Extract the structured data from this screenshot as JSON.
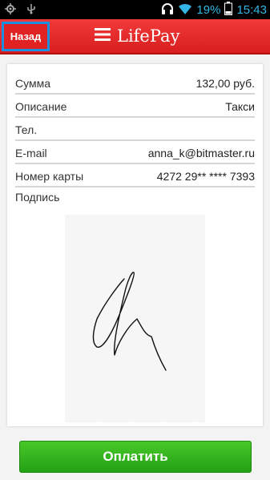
{
  "status_bar": {
    "battery_percent": "19%",
    "time": "15:43",
    "icons": [
      "location-icon",
      "usb-icon",
      "headset-icon",
      "wifi-icon",
      "battery-icon"
    ]
  },
  "header": {
    "back_label": "Назад",
    "brand": "LifePay",
    "menu_icon": "hamburger-menu-icon"
  },
  "receipt": {
    "rows": [
      {
        "label": "Сумма",
        "value": "132,00 руб."
      },
      {
        "label": "Описание",
        "value": "Такси"
      },
      {
        "label": "Тел.",
        "value": ""
      },
      {
        "label": "E-mail",
        "value": "anna_k@bitmaster.ru"
      },
      {
        "label": "Номер карты",
        "value": "4272 29** **** 7393"
      }
    ],
    "signature_label": "Подпись"
  },
  "pay_button": {
    "label": "Оплатить"
  },
  "colors": {
    "header": "#e02222",
    "accent_focus": "#1b8fe0",
    "pay": "#2fae1a",
    "status_text": "#33b5e5"
  }
}
